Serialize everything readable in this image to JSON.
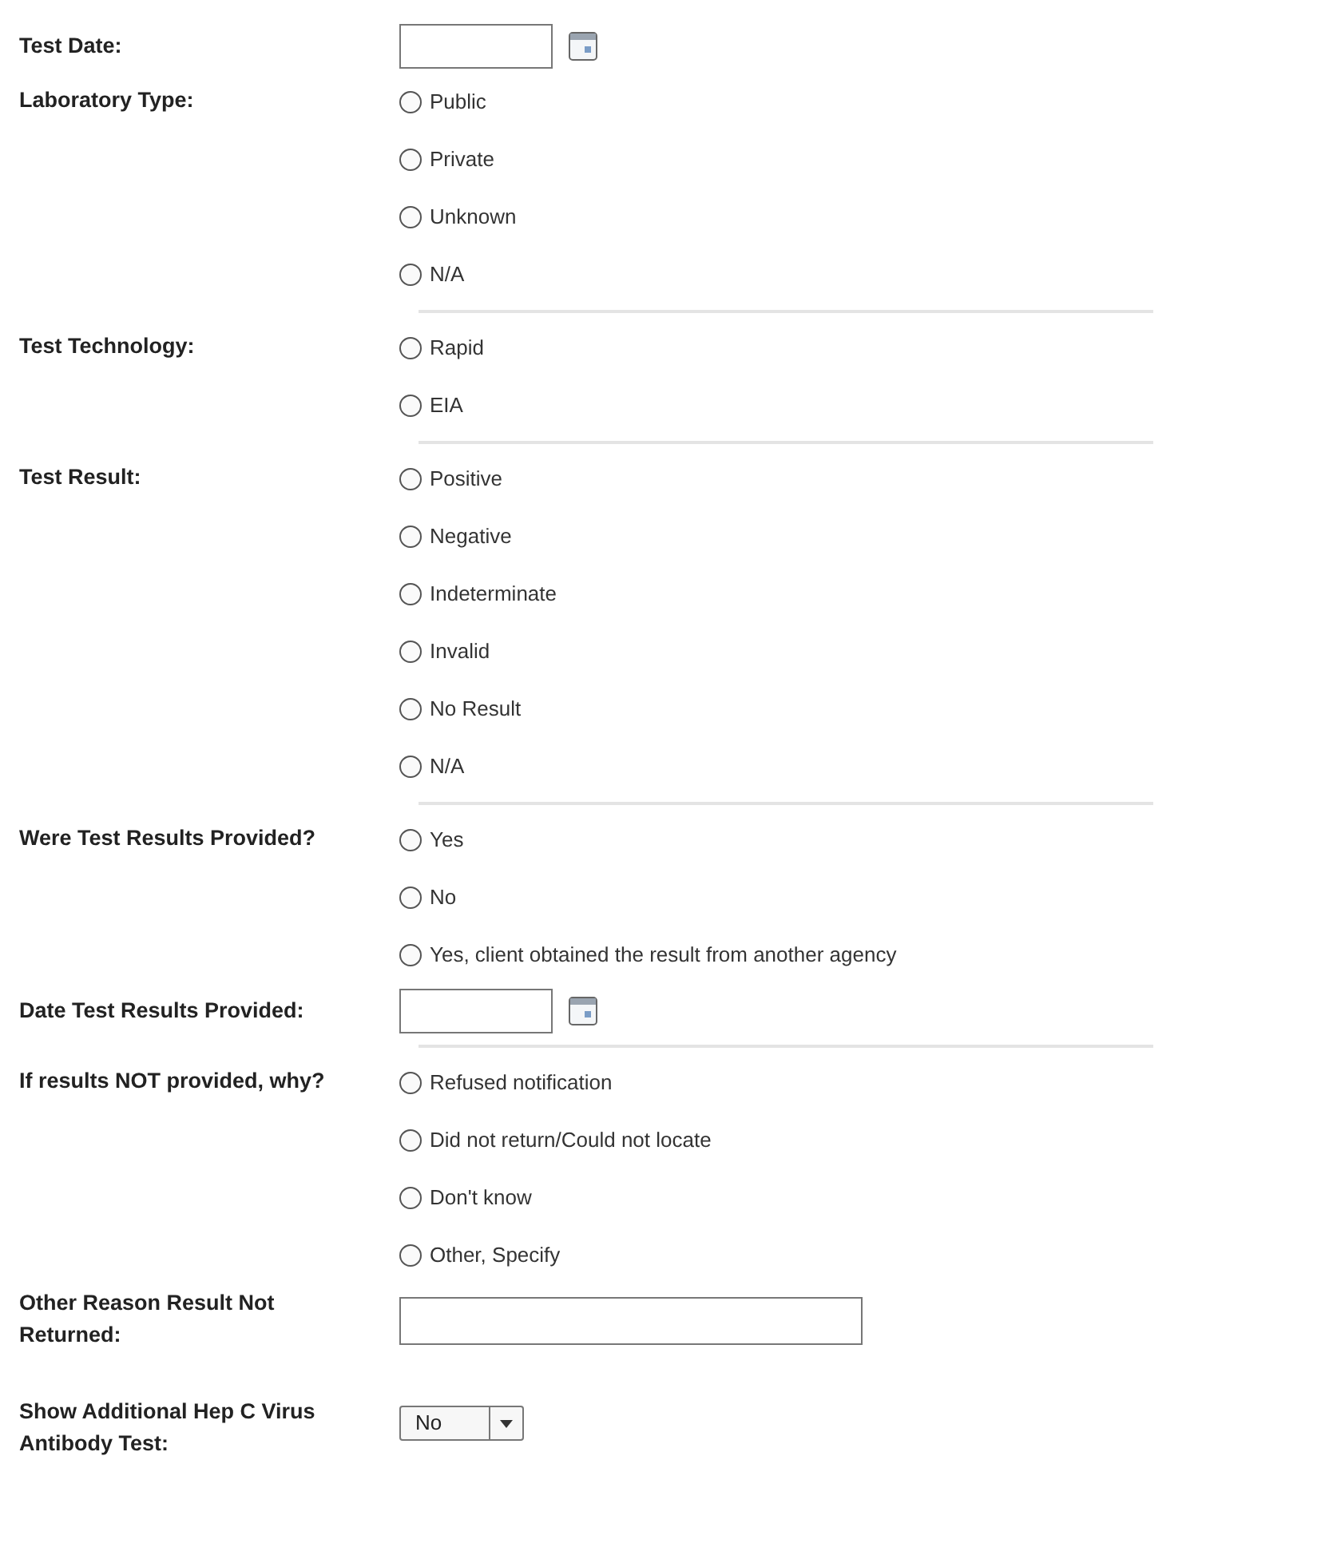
{
  "fields": [
    {
      "kind": "date",
      "label": "Test Date:",
      "divider": false
    },
    {
      "kind": "radio",
      "label": "Laboratory Type:",
      "divider": true,
      "options": [
        {
          "label": "Public",
          "selected": false
        },
        {
          "label": "Private",
          "selected": false
        },
        {
          "label": "Unknown",
          "selected": false
        },
        {
          "label": "N/A",
          "selected": false
        }
      ]
    },
    {
      "kind": "radio",
      "label": "Test Technology:",
      "divider": true,
      "options": [
        {
          "label": "Rapid",
          "selected": false
        },
        {
          "label": "EIA",
          "selected": false
        }
      ]
    },
    {
      "kind": "radio",
      "label": "Test Result:",
      "divider": true,
      "options": [
        {
          "label": "Positive",
          "selected": false
        },
        {
          "label": "Negative",
          "selected": false
        },
        {
          "label": "Indeterminate",
          "selected": false
        },
        {
          "label": "Invalid",
          "selected": false
        },
        {
          "label": "No Result",
          "selected": false
        },
        {
          "label": "N/A",
          "selected": false
        }
      ]
    },
    {
      "kind": "radio",
      "label": "Were Test Results Provided?",
      "divider": false,
      "options": [
        {
          "label": "Yes",
          "selected": false
        },
        {
          "label": "No",
          "selected": false
        },
        {
          "label": "Yes, client obtained the result from another agency",
          "selected": false
        }
      ]
    },
    {
      "kind": "date",
      "label": "Date Test Results Provided:",
      "divider": true
    },
    {
      "kind": "radio",
      "label": "If results NOT provided, why?",
      "divider": false,
      "options": [
        {
          "label": "Refused notification",
          "selected": false
        },
        {
          "label": "Did not return/Could not locate",
          "selected": false
        },
        {
          "label": "Don't know",
          "selected": false
        },
        {
          "label": "Other, Specify",
          "selected": false
        }
      ]
    },
    {
      "kind": "text",
      "label": "Other Reason Result Not Returned:",
      "divider": false
    },
    {
      "kind": "select",
      "label": "Show Additional Hep C Virus Antibody Test:",
      "divider": false,
      "value": "No"
    }
  ]
}
